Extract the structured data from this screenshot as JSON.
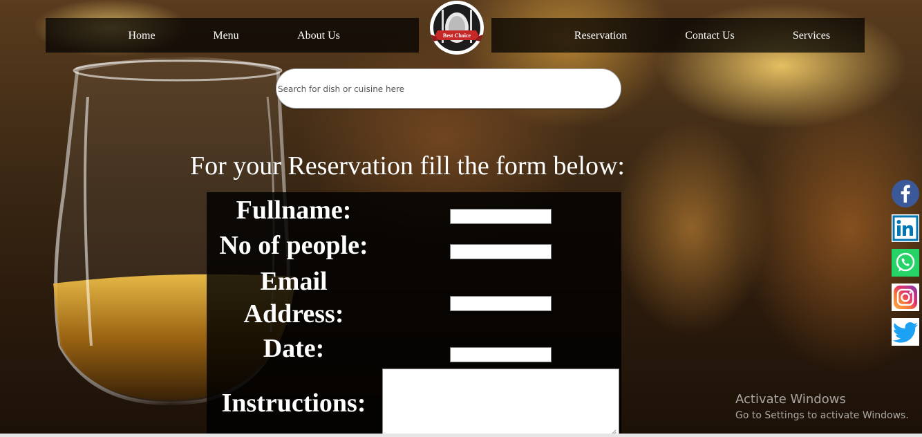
{
  "nav": {
    "left": [
      {
        "label": "Home"
      },
      {
        "label": "Menu"
      },
      {
        "label": "About Us"
      }
    ],
    "right": [
      {
        "label": "Reservation"
      },
      {
        "label": "Contact Us"
      },
      {
        "label": "Services"
      }
    ],
    "logo_text": "Best Choice"
  },
  "search": {
    "placeholder": "Search for dish or cuisine here"
  },
  "form": {
    "heading": "For your Reservation fill the form below:",
    "fullname_label": "Fullname:",
    "people_label": "No of people:",
    "email_label_line1": "Email",
    "email_label_line2": "Address:",
    "date_label": "Date:",
    "instructions_label": "Instructions:"
  },
  "social": [
    {
      "icon": "facebook-icon",
      "color": "#3b5998"
    },
    {
      "icon": "linkedin-icon",
      "color": "#0077b5"
    },
    {
      "icon": "whatsapp-icon",
      "color": "#25d366"
    },
    {
      "icon": "instagram-icon",
      "color": "#c13584"
    },
    {
      "icon": "twitter-icon",
      "color": "#1da1f2"
    }
  ],
  "watermark": {
    "line1": "Activate Windows",
    "line2": "Go to Settings to activate Windows."
  }
}
